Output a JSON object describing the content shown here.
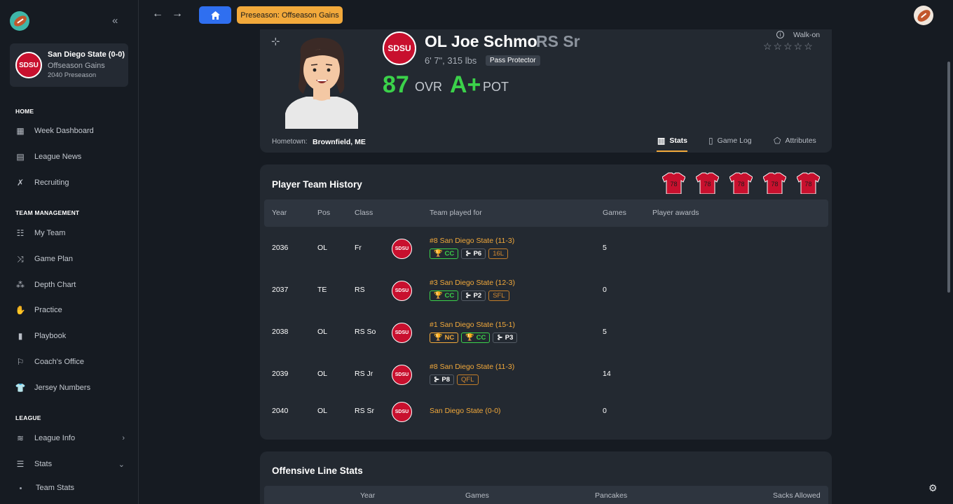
{
  "sidebar": {
    "team": {
      "badge": "SDSU",
      "name": "San Diego State (0-0)",
      "phase": "Offseason Gains",
      "season": "2040 Preseason"
    },
    "sections": [
      {
        "title": "HOME",
        "items": [
          {
            "label": "Week Dashboard",
            "icon": "dashboard-icon"
          },
          {
            "label": "League News",
            "icon": "news-icon"
          },
          {
            "label": "Recruiting",
            "icon": "recruiting-icon"
          }
        ]
      },
      {
        "title": "TEAM MANAGEMENT",
        "items": [
          {
            "label": "My Team",
            "icon": "team-icon"
          },
          {
            "label": "Game Plan",
            "icon": "gameplan-icon"
          },
          {
            "label": "Depth Chart",
            "icon": "depth-chart-icon"
          },
          {
            "label": "Practice",
            "icon": "practice-icon"
          },
          {
            "label": "Playbook",
            "icon": "playbook-icon"
          },
          {
            "label": "Coach's Office",
            "icon": "coach-office-icon"
          },
          {
            "label": "Jersey Numbers",
            "icon": "jersey-icon"
          }
        ]
      },
      {
        "title": "LEAGUE",
        "items": [
          {
            "label": "League Info",
            "icon": "league-icon"
          },
          {
            "label": "Stats",
            "icon": "database-icon"
          },
          {
            "label": "Team Stats",
            "icon": "dot-icon"
          }
        ]
      }
    ]
  },
  "topbar": {
    "phase_button": "Preseason: Offseason Gains"
  },
  "player": {
    "badge": "SDSU",
    "name": "OL Joe Schmo",
    "class": "RS Sr",
    "size": "6' 7\", 315 lbs",
    "archetype": "Pass Protector",
    "ovr": "87",
    "ovr_label": "OVR",
    "pot": "A+",
    "pot_label": "POT",
    "recruit_type": "Walk-on",
    "stars": "☆☆☆☆☆",
    "hometown_label": "Hometown:",
    "hometown": "Brownfield, ME",
    "tabs": [
      "Stats",
      "Game Log",
      "Attributes"
    ]
  },
  "history": {
    "title": "Player Team History",
    "jersey_number": "78",
    "columns": [
      "Year",
      "Pos",
      "Class",
      "Team played for",
      "Games",
      "Player awards"
    ],
    "rows": [
      {
        "year": "2036",
        "pos": "OL",
        "class": "Fr",
        "badge": "SDSU",
        "team": "#8 San Diego State (11-3)",
        "games": "5",
        "chips": [
          {
            "style": "green",
            "icon": "trophy-icon",
            "text": "CC"
          },
          {
            "style": "plain",
            "icon": "bracket-icon",
            "text": "P6"
          },
          {
            "style": "orange",
            "icon": "",
            "text": "16L"
          }
        ]
      },
      {
        "year": "2037",
        "pos": "TE",
        "class": "RS",
        "badge": "SDSU",
        "team": "#3 San Diego State (12-3)",
        "games": "0",
        "chips": [
          {
            "style": "green",
            "icon": "trophy-icon",
            "text": "CC"
          },
          {
            "style": "plain",
            "icon": "bracket-icon",
            "text": "P2"
          },
          {
            "style": "orange",
            "icon": "",
            "text": "SFL"
          }
        ]
      },
      {
        "year": "2038",
        "pos": "OL",
        "class": "RS So",
        "badge": "SDSU",
        "team": "#1 San Diego State (15-1)",
        "games": "5",
        "chips": [
          {
            "style": "gold",
            "icon": "trophy-icon",
            "text": "NC"
          },
          {
            "style": "green",
            "icon": "trophy-icon",
            "text": "CC"
          },
          {
            "style": "plain",
            "icon": "bracket-icon",
            "text": "P3"
          }
        ]
      },
      {
        "year": "2039",
        "pos": "OL",
        "class": "RS Jr",
        "badge": "SDSU",
        "team": "#8 San Diego State (11-3)",
        "games": "14",
        "chips": [
          {
            "style": "plain",
            "icon": "bracket-icon",
            "text": "P8"
          },
          {
            "style": "orange",
            "icon": "",
            "text": "QFL"
          }
        ]
      },
      {
        "year": "2040",
        "pos": "OL",
        "class": "RS Sr",
        "badge": "SDSU",
        "team": "San Diego State (0-0)",
        "games": "0",
        "chips": []
      }
    ]
  },
  "ol_stats": {
    "title": "Offensive Line Stats",
    "columns": [
      "Year",
      "Games",
      "Pancakes",
      "Sacks Allowed"
    ]
  },
  "colors": {
    "accent": "#f2a93b",
    "primary": "#2f6ff0",
    "positive": "#3bd24a",
    "team": "#c8102e"
  }
}
